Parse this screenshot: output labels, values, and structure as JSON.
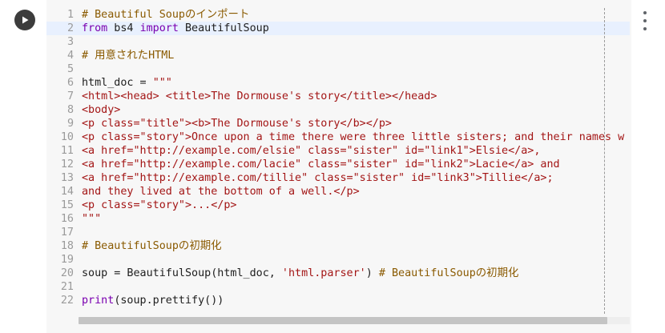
{
  "cell": {
    "run_icon": "play-icon",
    "more_icon": "more-vert-icon",
    "active_line": 2
  },
  "lines": [
    {
      "n": "1",
      "parts": [
        {
          "t": "# Beautiful Soupのインポート",
          "c": "c-comment"
        }
      ]
    },
    {
      "n": "2",
      "parts": [
        {
          "t": "from",
          "c": "c-kw"
        },
        {
          "t": " bs4 ",
          "c": ""
        },
        {
          "t": "import",
          "c": "c-kw"
        },
        {
          "t": " BeautifulSoup",
          "c": ""
        }
      ]
    },
    {
      "n": "3",
      "parts": []
    },
    {
      "n": "4",
      "parts": [
        {
          "t": "# 用意されたHTML",
          "c": "c-comment"
        }
      ]
    },
    {
      "n": "5",
      "parts": []
    },
    {
      "n": "6",
      "parts": [
        {
          "t": "html_doc = ",
          "c": ""
        },
        {
          "t": "\"\"\"",
          "c": "c-string"
        }
      ]
    },
    {
      "n": "7",
      "parts": [
        {
          "t": "<html><head> <title>The Dormouse's story</title></head>",
          "c": "c-tag"
        }
      ]
    },
    {
      "n": "8",
      "parts": [
        {
          "t": "<body>",
          "c": "c-tag"
        }
      ]
    },
    {
      "n": "9",
      "parts": [
        {
          "t": "<p class=\"title\"><b>The Dormouse's story</b></p>",
          "c": "c-tag"
        }
      ]
    },
    {
      "n": "10",
      "parts": [
        {
          "t": "<p class=\"story\">Once upon a time there were three little sisters; and their names w",
          "c": "c-tag"
        }
      ]
    },
    {
      "n": "11",
      "parts": [
        {
          "t": "<a href=\"http://example.com/elsie\" class=\"sister\" id=\"link1\">Elsie</a>,",
          "c": "c-tag"
        }
      ]
    },
    {
      "n": "12",
      "parts": [
        {
          "t": "<a href=\"http://example.com/lacie\" class=\"sister\" id=\"link2\">Lacie</a> and",
          "c": "c-tag"
        }
      ]
    },
    {
      "n": "13",
      "parts": [
        {
          "t": "<a href=\"http://example.com/tillie\" class=\"sister\" id=\"link3\">Tillie</a>;",
          "c": "c-tag"
        }
      ]
    },
    {
      "n": "14",
      "parts": [
        {
          "t": "and they lived at the bottom of a well.</p>",
          "c": "c-tag"
        }
      ]
    },
    {
      "n": "15",
      "parts": [
        {
          "t": "<p class=\"story\">...</p>",
          "c": "c-tag"
        }
      ]
    },
    {
      "n": "16",
      "parts": [
        {
          "t": "\"\"\"",
          "c": "c-string"
        }
      ]
    },
    {
      "n": "17",
      "parts": []
    },
    {
      "n": "18",
      "parts": [
        {
          "t": "# BeautifulSoupの初期化",
          "c": "c-comment"
        }
      ]
    },
    {
      "n": "19",
      "parts": []
    },
    {
      "n": "20",
      "parts": [
        {
          "t": "soup = BeautifulSoup(html_doc, ",
          "c": ""
        },
        {
          "t": "'html.parser'",
          "c": "c-string"
        },
        {
          "t": ") ",
          "c": ""
        },
        {
          "t": "# BeautifulSoupの初期化",
          "c": "c-comment"
        }
      ]
    },
    {
      "n": "21",
      "parts": []
    },
    {
      "n": "22",
      "parts": [
        {
          "t": "print",
          "c": "c-builtin"
        },
        {
          "t": "(soup.prettify())",
          "c": ""
        }
      ]
    }
  ]
}
